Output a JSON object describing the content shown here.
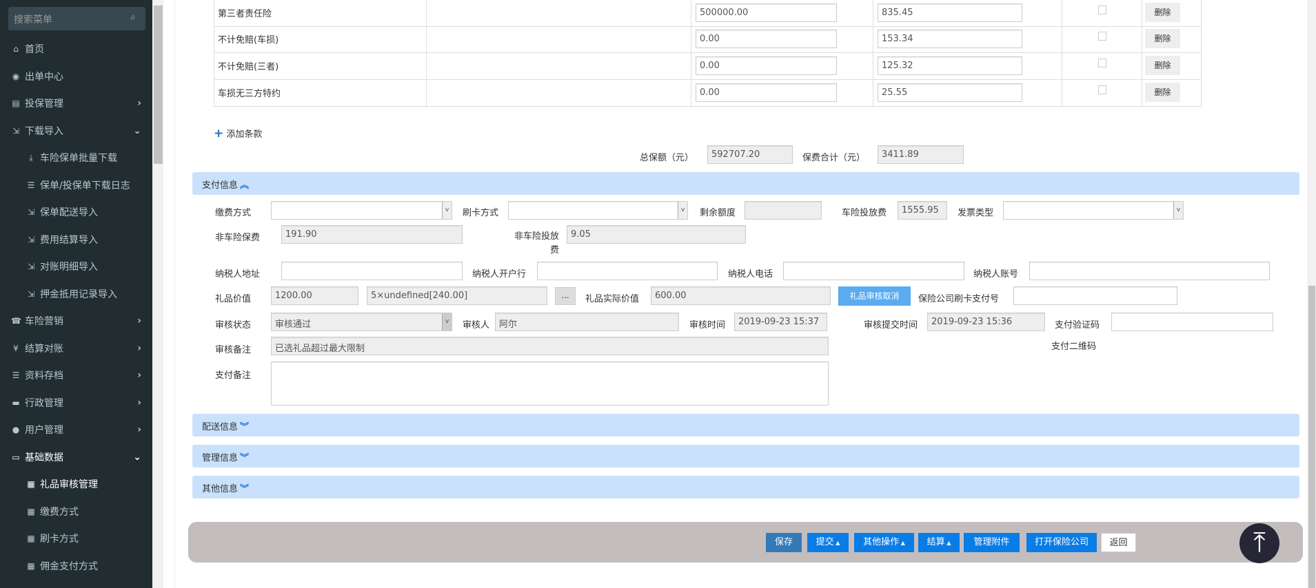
{
  "sidebar": {
    "search_placeholder": "搜索菜单",
    "items": [
      {
        "label": "首页",
        "icon": "home-icon",
        "glyph": "⌂"
      },
      {
        "label": "出单中心",
        "icon": "globe-icon",
        "glyph": "◉"
      },
      {
        "label": "投保管理",
        "icon": "file-icon",
        "glyph": "▤",
        "chev": "›"
      },
      {
        "label": "下载导入",
        "icon": "import-icon",
        "glyph": "⇲",
        "chev": "⌄"
      },
      {
        "label": "车险保单批量下载",
        "icon": "download-icon",
        "glyph": "⤓",
        "sub": true
      },
      {
        "label": "保单/投保单下载日志",
        "icon": "list-icon",
        "glyph": "☰",
        "sub": true
      },
      {
        "label": "保单配送导入",
        "icon": "import-icon",
        "glyph": "⇲",
        "sub": true
      },
      {
        "label": "费用结算导入",
        "icon": "import-icon",
        "glyph": "⇲",
        "sub": true
      },
      {
        "label": "对账明细导入",
        "icon": "import-icon",
        "glyph": "⇲",
        "sub": true
      },
      {
        "label": "押金抵用记录导入",
        "icon": "import-icon",
        "glyph": "⇲",
        "sub": true
      },
      {
        "label": "车险营销",
        "icon": "phone-icon",
        "glyph": "☎",
        "chev": "›"
      },
      {
        "label": "结算对账",
        "icon": "yen-icon",
        "glyph": "¥",
        "chev": "›"
      },
      {
        "label": "资料存档",
        "icon": "list-icon",
        "glyph": "☰",
        "chev": "›"
      },
      {
        "label": "行政管理",
        "icon": "folder-icon",
        "glyph": "▬",
        "chev": "›"
      },
      {
        "label": "用户管理",
        "icon": "user-icon",
        "glyph": "●",
        "chev": "›"
      },
      {
        "label": "基础数据",
        "icon": "drive-icon",
        "glyph": "▭",
        "chev": "⌄",
        "active": true
      },
      {
        "label": "礼品审核管理",
        "icon": "grid-icon",
        "glyph": "▦",
        "sub": true,
        "active": true
      },
      {
        "label": "缴费方式",
        "icon": "grid-icon",
        "glyph": "▦",
        "sub": true
      },
      {
        "label": "刷卡方式",
        "icon": "grid-icon",
        "glyph": "▦",
        "sub": true
      },
      {
        "label": "佣金支付方式",
        "icon": "grid-icon",
        "glyph": "▦",
        "sub": true
      }
    ]
  },
  "table": {
    "delete_label": "删除",
    "rows": [
      {
        "name": "第三者责任险",
        "amount": "500000.00",
        "premium": "835.45"
      },
      {
        "name": "不计免赔(车损)",
        "amount": "0.00",
        "premium": "153.34"
      },
      {
        "name": "不计免赔(三者)",
        "amount": "0.00",
        "premium": "125.32"
      },
      {
        "name": "车损无三方特约",
        "amount": "0.00",
        "premium": "25.55"
      }
    ]
  },
  "add_clause": "添加条款",
  "totals": {
    "sum_label": "总保额（元）",
    "sum": "592707.20",
    "fee_label": "保费合计（元）",
    "fee": "3411.89"
  },
  "payment": {
    "title": "支付信息",
    "pay_method": "缴费方式",
    "card_method": "刷卡方式",
    "remaining": "剩余额度",
    "car_fee": "车险投放费",
    "car_fee_val": "1555.95",
    "invoice_type": "发票类型",
    "noncar_premium": "非车险保费",
    "noncar_premium_val": "191.90",
    "noncar_fee": "非车险投放费",
    "noncar_fee_val": "9.05",
    "tax_addr": "纳税人地址",
    "tax_bank": "纳税人开户行",
    "tax_phone": "纳税人电话",
    "tax_account": "纳税人账号",
    "gift_value": "礼品价值",
    "gift_value_val": "1200.00",
    "gift_detail_val": "5×undefined[240.00]",
    "more_btn": "...",
    "gift_actual": "礼品实际价值",
    "gift_actual_val": "600.00",
    "gift_cancel_btn": "礼品审核取消",
    "card_pay_no": "保险公司刷卡支付号",
    "audit_status": "审核状态",
    "audit_status_val": "审核通过",
    "auditor": "审核人",
    "auditor_val": "阿尔",
    "audit_time": "审核时间",
    "audit_time_val": "2019-09-23 15:37",
    "submit_time": "审核提交时间",
    "submit_time_val": "2019-09-23 15:36",
    "verify_code": "支付验证码",
    "audit_note": "审核备注",
    "audit_note_val": "已选礼品超过最大限制",
    "qr": "支付二维码",
    "pay_note": "支付备注"
  },
  "sections": {
    "delivery": "配送信息",
    "manage": "管理信息",
    "other": "其他信息"
  },
  "actions": {
    "save": "保存",
    "submit": "提交",
    "other_ops": "其他操作",
    "settle": "结算",
    "attachments": "管理附件",
    "open_company": "打开保险公司",
    "back": "返回"
  }
}
